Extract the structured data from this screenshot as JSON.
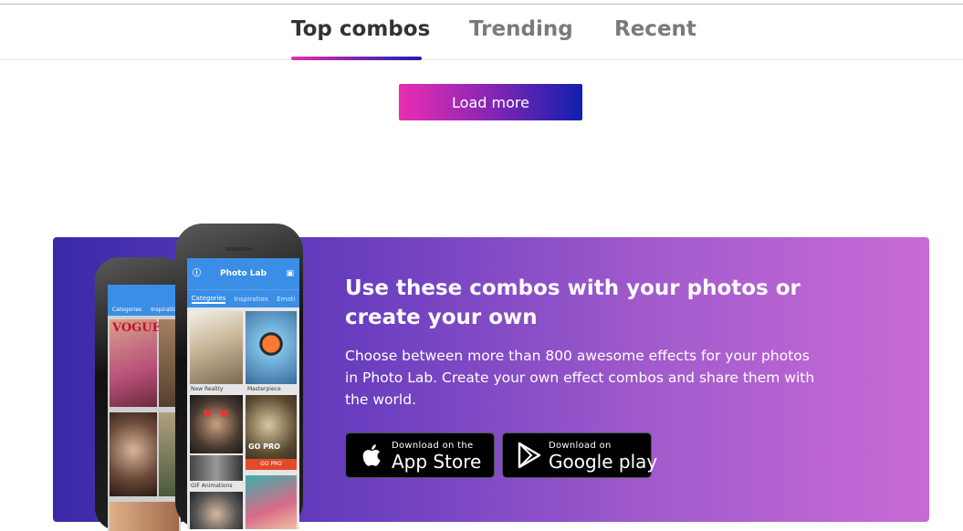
{
  "tabs": [
    {
      "label": "Top combos",
      "active": true
    },
    {
      "label": "Trending",
      "active": false
    },
    {
      "label": "Recent",
      "active": false
    }
  ],
  "load_more_label": "Load more",
  "promo": {
    "title": "Use these combos with your photos or create your own",
    "text": "Choose between more than 800 awesome effects for your photos in Photo Lab. Create your own effect combos and share them with the world."
  },
  "app_store": {
    "small": "Download on the",
    "big": "App Store",
    "icon": "apple-icon"
  },
  "google_play": {
    "small": "Download on",
    "big": "Google play",
    "icon": "play-icon"
  },
  "phone_app": {
    "title": "Photo Lab",
    "tabs": [
      "Categories",
      "Inspiration",
      "Emoti"
    ],
    "captions": [
      "New Reality",
      "Masterpiece",
      "GIF Animations",
      "GO PRO"
    ],
    "back_phone_text": "VOGUE",
    "back_phone_tabs": [
      "Categories",
      "Inspiratio"
    ],
    "pro_text": "GO PRO"
  },
  "colors": {
    "tab_accent_start": "#e62dae",
    "tab_accent_end": "#1a1fb0",
    "promo_start": "#3a2aa8",
    "promo_end": "#c96ad6"
  }
}
